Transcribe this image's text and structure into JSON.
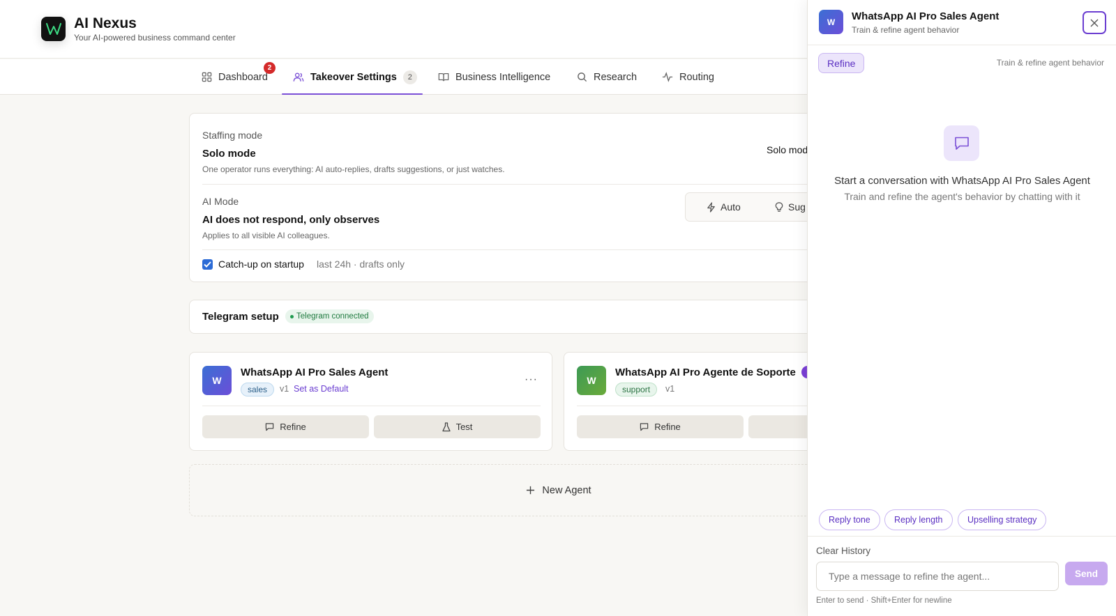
{
  "app": {
    "title": "AI Nexus",
    "subtitle": "Your AI-powered business command center",
    "logo_icon": "w-logo-icon"
  },
  "tabs": [
    {
      "label": "Dashboard",
      "icon": "grid-icon",
      "badge": "2"
    },
    {
      "label": "Takeover Settings",
      "icon": "users-icon",
      "count": "2",
      "active": true
    },
    {
      "label": "Business Intelligence",
      "icon": "book-icon"
    },
    {
      "label": "Research",
      "icon": "search-icon"
    },
    {
      "label": "Routing",
      "icon": "activity-icon"
    }
  ],
  "settings": {
    "staffing_label": "Staffing mode",
    "staffing_title": "Solo mode",
    "staffing_desc": "One operator runs everything: AI auto-replies, drafts suggestions, or just watches.",
    "staffing_value": "Solo mod",
    "ai_mode_label": "AI Mode",
    "ai_mode_title": "AI does not respond, only observes",
    "ai_mode_desc": "Applies to all visible AI colleagues.",
    "mode_auto": "Auto",
    "mode_suggest": "Sug",
    "catchup_label": "Catch-up on startup",
    "catchup_note": "last 24h · drafts only",
    "catchup_checked": true
  },
  "telegram": {
    "title": "Telegram setup",
    "badge": "Telegram connected"
  },
  "agents": [
    {
      "initial": "W",
      "name": "WhatsApp AI Pro Sales Agent",
      "tag": "sales",
      "version": "v1",
      "default_link": "Set as Default",
      "more": "···",
      "refine_label": "Refine",
      "test_label": "Test"
    },
    {
      "initial": "W",
      "name": "WhatsApp AI Pro Agente de Soporte",
      "tag": "support",
      "version": "v1",
      "refine_label": "Refine"
    }
  ],
  "new_agent_label": "New Agent",
  "panel": {
    "avatar": "W",
    "title": "WhatsApp AI Pro Sales Agent",
    "subtitle": "Train & refine agent behavior",
    "refine_pill": "Refine",
    "note": "Train & refine agent behavior",
    "empty_title": "Start a conversation with WhatsApp AI Pro Sales Agent",
    "empty_sub": "Train and refine the agent's behavior by chatting with it",
    "chips": [
      "Reply tone",
      "Reply length",
      "Upselling strategy"
    ],
    "clear_history": "Clear History",
    "input_placeholder": "Type a message to refine the agent...",
    "send_label": "Send",
    "hint": "Enter to send · Shift+Enter for newline"
  },
  "colors": {
    "accent": "#7a4fd6",
    "badge_red": "#d42a2a",
    "checkbox_blue": "#2b6bd6",
    "telegram_green": "#1f7a3f"
  }
}
